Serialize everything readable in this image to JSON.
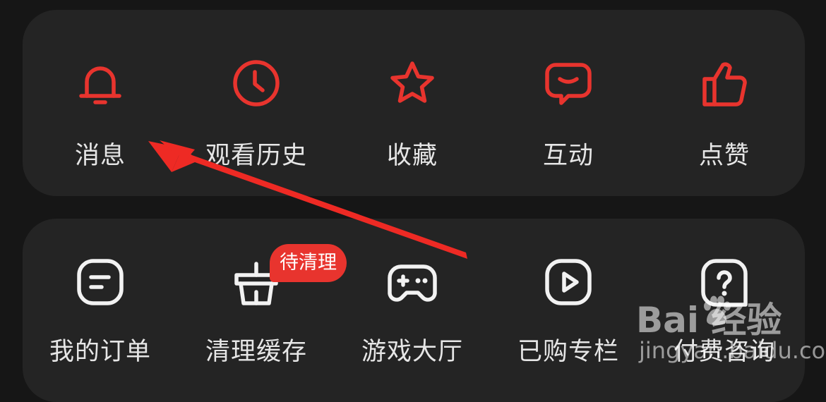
{
  "top_row": [
    {
      "label": "消息",
      "icon": "bell-icon"
    },
    {
      "label": "观看历史",
      "icon": "clock-icon"
    },
    {
      "label": "收藏",
      "icon": "star-icon"
    },
    {
      "label": "互动",
      "icon": "chat-bubble-icon"
    },
    {
      "label": "点赞",
      "icon": "thumbs-up-icon"
    }
  ],
  "bottom_row": [
    {
      "label": "我的订单",
      "icon": "order-icon"
    },
    {
      "label": "清理缓存",
      "icon": "clean-bucket-icon",
      "badge": "待清理"
    },
    {
      "label": "游戏大厅",
      "icon": "gamepad-icon"
    },
    {
      "label": "已购专栏",
      "icon": "play-icon"
    },
    {
      "label": "付费咨询",
      "icon": "question-icon"
    }
  ],
  "watermark": {
    "brand": "Bai  经验",
    "url": "jingyan.baidu.com"
  },
  "colors": {
    "accent": "#e8342e",
    "card": "#242424",
    "background": "#161616",
    "arrow": "#ee2a24"
  }
}
